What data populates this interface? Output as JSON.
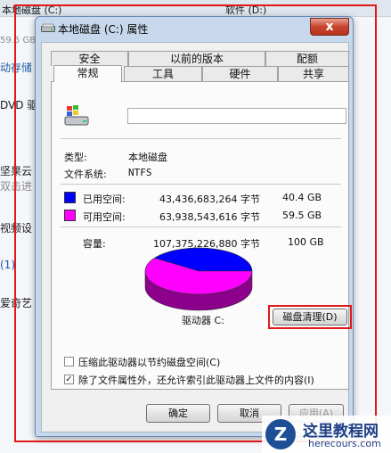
{
  "background": {
    "drive_c": "本地磁盘 (C:)",
    "drive_d": "软件 (D:)",
    "size_hint": "59.5 GB",
    "left_items": [
      "动存储",
      "DVD 驱",
      "坚果云",
      "双击进",
      "视频设",
      "(1)",
      "爱奇艺"
    ]
  },
  "dialog": {
    "title": "本地磁盘 (C:) 属性",
    "close_glyph": "x",
    "tabs_back": [
      "安全",
      "以前的版本",
      "配额"
    ],
    "tabs_front": [
      "常规",
      "工具",
      "硬件",
      "共享"
    ],
    "type_label": "类型:",
    "type_value": "本地磁盘",
    "fs_label": "文件系统:",
    "fs_value": "NTFS",
    "used": {
      "label": "已用空间:",
      "bytes": "43,436,683,264 字节",
      "size": "40.4 GB",
      "color": "#0000ff"
    },
    "free": {
      "label": "可用空间:",
      "bytes": "63,938,543,616 字节",
      "size": "59.5 GB",
      "color": "#ff00ff"
    },
    "capacity": {
      "label": "容量:",
      "bytes": "107,375,226,880 字节",
      "size": "100 GB"
    },
    "drive_label": "驱动器 C:",
    "cleanup_button": "磁盘清理(D)",
    "compress_label": "压缩此驱动器以节约磁盘空间(C)",
    "compress_checked": false,
    "index_label": "除了文件属性外，还允许索引此驱动器上文件的内容(I)",
    "index_checked": true,
    "ok_button": "确定",
    "cancel_button": "取消",
    "apply_button": "应用(A)"
  },
  "chart_data": {
    "type": "pie",
    "categories": [
      "已用空间",
      "可用空间"
    ],
    "values": [
      40.4,
      59.5
    ],
    "colors": [
      "#0000ff",
      "#ff00ff"
    ]
  },
  "watermark": {
    "logo_letter": "Z",
    "name": "这里教程网",
    "url": "herecours.com"
  }
}
